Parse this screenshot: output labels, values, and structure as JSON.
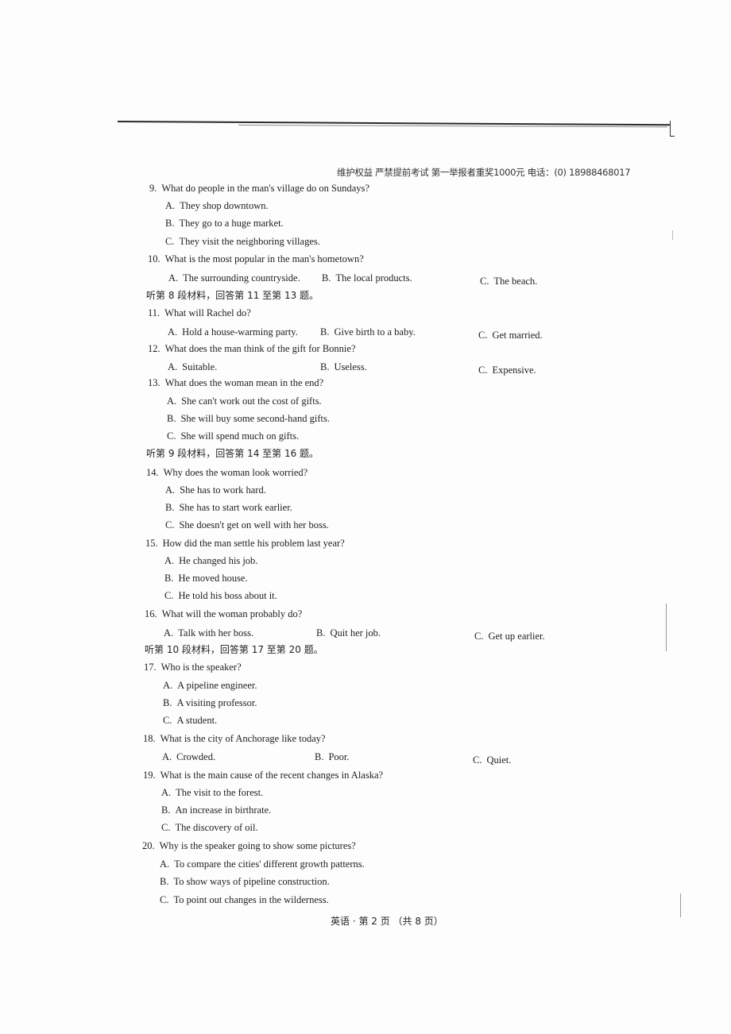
{
  "header": {
    "notice": "维护权益  严禁提前考试  第一举报者重奖1000元  电话：(0) 18988468017"
  },
  "questions": [
    {
      "num": "9.",
      "text": "What do people in the man's village do on Sundays?",
      "options": [
        {
          "letter": "A.",
          "text": "They shop downtown."
        },
        {
          "letter": "B.",
          "text": "They go to a huge market."
        },
        {
          "letter": "C.",
          "text": "They visit the neighboring villages."
        }
      ]
    },
    {
      "num": "10.",
      "text": "What is the most popular in the man's hometown?",
      "options": [
        {
          "letter": "A.",
          "text": "The surrounding countryside."
        },
        {
          "letter": "B.",
          "text": "The local products."
        },
        {
          "letter": "C.",
          "text": "The beach."
        }
      ]
    },
    {
      "num": "11.",
      "text": "What will Rachel do?",
      "options": [
        {
          "letter": "A.",
          "text": "Hold a house-warming party."
        },
        {
          "letter": "B.",
          "text": "Give birth to a baby."
        },
        {
          "letter": "C.",
          "text": "Get married."
        }
      ]
    },
    {
      "num": "12.",
      "text": "What does the man think of the gift for Bonnie?",
      "options": [
        {
          "letter": "A.",
          "text": "Suitable."
        },
        {
          "letter": "B.",
          "text": "Useless."
        },
        {
          "letter": "C.",
          "text": "Expensive."
        }
      ]
    },
    {
      "num": "13.",
      "text": "What does the woman mean in the end?",
      "options": [
        {
          "letter": "A.",
          "text": "She can't work out the cost of gifts."
        },
        {
          "letter": "B.",
          "text": "She will buy some second-hand gifts."
        },
        {
          "letter": "C.",
          "text": "She will spend much on gifts."
        }
      ]
    },
    {
      "num": "14.",
      "text": "Why does the woman look worried?",
      "options": [
        {
          "letter": "A.",
          "text": "She has to work hard."
        },
        {
          "letter": "B.",
          "text": "She has to start work earlier."
        },
        {
          "letter": "C.",
          "text": "She doesn't get on well with her boss."
        }
      ]
    },
    {
      "num": "15.",
      "text": "How did the man settle his problem last year?",
      "options": [
        {
          "letter": "A.",
          "text": "He changed his job."
        },
        {
          "letter": "B.",
          "text": "He moved house."
        },
        {
          "letter": "C.",
          "text": "He told his boss about it."
        }
      ]
    },
    {
      "num": "16.",
      "text": "What will the woman probably do?",
      "options": [
        {
          "letter": "A.",
          "text": "Talk with her boss."
        },
        {
          "letter": "B.",
          "text": "Quit her job."
        },
        {
          "letter": "C.",
          "text": "Get up earlier."
        }
      ]
    },
    {
      "num": "17.",
      "text": "Who is the speaker?",
      "options": [
        {
          "letter": "A.",
          "text": "A pipeline engineer."
        },
        {
          "letter": "B.",
          "text": "A visiting professor."
        },
        {
          "letter": "C.",
          "text": "A student."
        }
      ]
    },
    {
      "num": "18.",
      "text": "What is the city of Anchorage like today?",
      "options": [
        {
          "letter": "A.",
          "text": "Crowded."
        },
        {
          "letter": "B.",
          "text": "Poor."
        },
        {
          "letter": "C.",
          "text": "Quiet."
        }
      ]
    },
    {
      "num": "19.",
      "text": "What is the main cause of the recent changes in Alaska?",
      "options": [
        {
          "letter": "A.",
          "text": "The visit to the forest."
        },
        {
          "letter": "B.",
          "text": "An increase in birthrate."
        },
        {
          "letter": "C.",
          "text": "The discovery of oil."
        }
      ]
    },
    {
      "num": "20.",
      "text": "Why is the speaker going to show some pictures?",
      "options": [
        {
          "letter": "A.",
          "text": "To compare the cities' different growth patterns."
        },
        {
          "letter": "B.",
          "text": "To show ways of pipeline construction."
        },
        {
          "letter": "C.",
          "text": "To point out changes in the wilderness."
        }
      ]
    }
  ],
  "section_notes": [
    "听第 8 段材料，回答第 11 至第 13 题。",
    "听第 9 段材料，回答第 14 至第 16 题。",
    "听第 10 段材料，回答第 17 至第 20 题。"
  ],
  "footer": {
    "page_label": "英语 · 第 2 页 （共 8 页）"
  }
}
